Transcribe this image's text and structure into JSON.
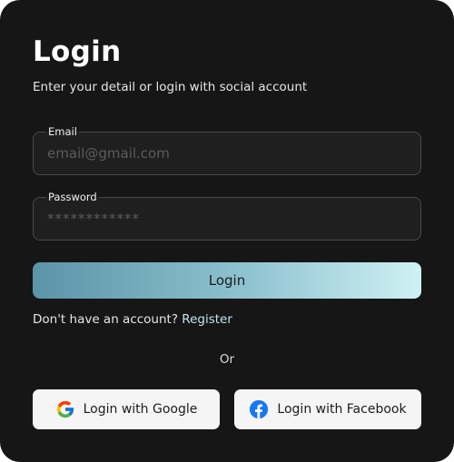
{
  "header": {
    "title": "Login",
    "subtitle": "Enter your detail or login with social account"
  },
  "form": {
    "email": {
      "label": "Email",
      "placeholder": "email@gmail.com",
      "value": ""
    },
    "password": {
      "label": "Password",
      "placeholder": "************",
      "value": ""
    },
    "submit_label": "Login"
  },
  "register": {
    "prompt": "Don't have an account?",
    "link_label": "Register"
  },
  "divider_text": "Or",
  "social": {
    "google": {
      "label": "Login with Google",
      "icon": "google-icon"
    },
    "facebook": {
      "label": "Login with Facebook",
      "icon": "facebook-icon"
    }
  },
  "colors": {
    "card_background": "#161616",
    "field_border": "#4a4a4a",
    "button_gradient_start": "#5a94a7",
    "button_gradient_end": "#cff1f4",
    "link": "#bfe6ee",
    "social_button_bg": "#f5f5f5",
    "facebook_blue": "#1877f2"
  }
}
